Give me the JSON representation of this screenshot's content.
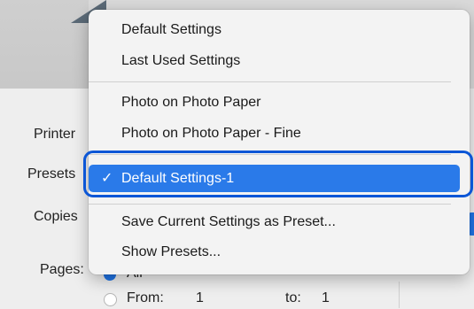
{
  "dialog": {
    "printer_label": "Printer",
    "presets_label": "Presets",
    "copies_label": "Copies",
    "pages_label": "Pages:",
    "pages_all_label": "All",
    "pages_from_label": "From:",
    "pages_from_value": "1",
    "pages_to_label": "to:",
    "pages_to_value": "1"
  },
  "menu": {
    "items_top": [
      "Default Settings",
      "Last Used Settings"
    ],
    "items_mid": [
      "Photo on Photo Paper",
      "Photo on Photo Paper - Fine"
    ],
    "selected_item": "Default Settings-1",
    "checkmark": "✓",
    "items_bottom": [
      "Save Current Settings as Preset...",
      "Show Presets..."
    ]
  },
  "colors": {
    "accent": "#2a7ae9",
    "highlight_ring": "#0b56d6"
  }
}
